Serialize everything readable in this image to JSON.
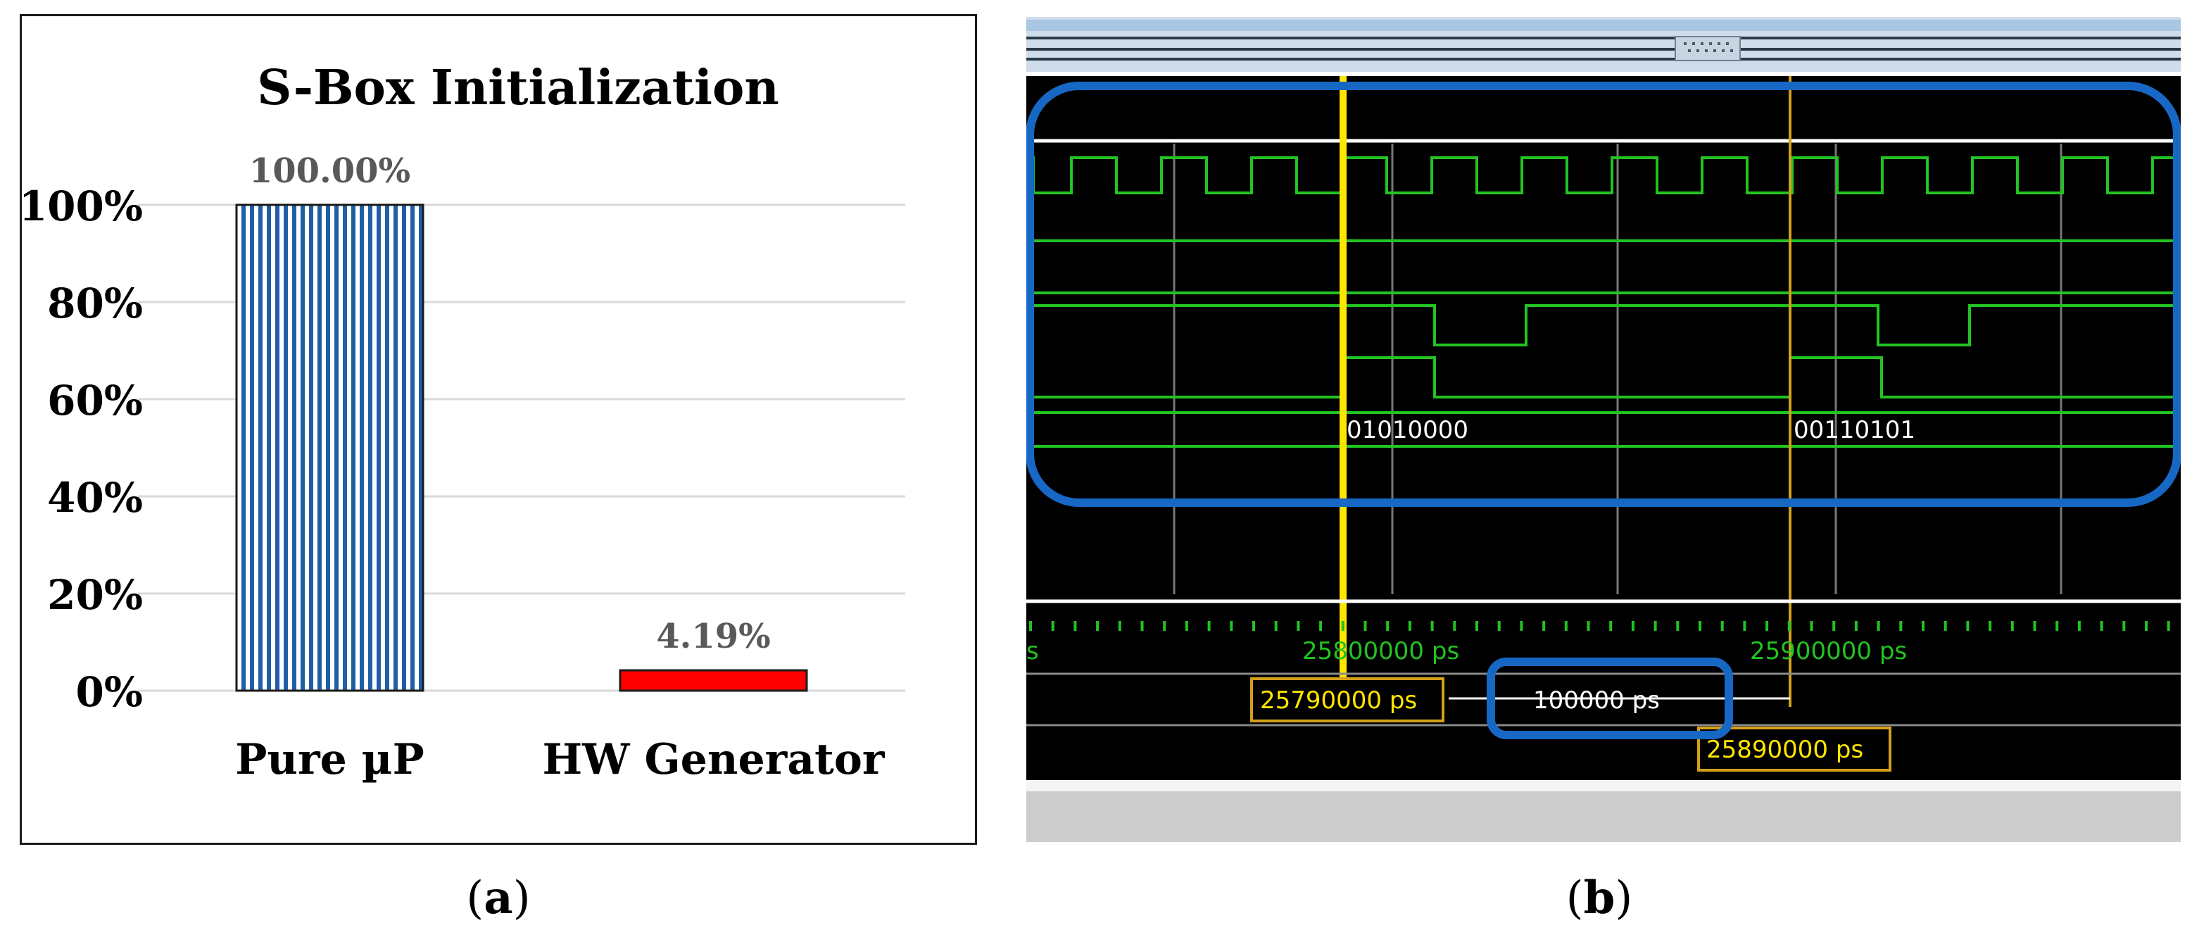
{
  "chart_data": {
    "type": "bar",
    "title": "S-Box Initialization",
    "categories": [
      "Pure µP",
      "HW Generator"
    ],
    "series": [
      {
        "values": [
          100.0,
          4.19
        ]
      }
    ],
    "data_labels": [
      "100.00%",
      "4.19%"
    ],
    "ylim": [
      0,
      100
    ],
    "y_ticks": [
      "0%",
      "20%",
      "40%",
      "60%",
      "80%",
      "100%"
    ],
    "y_tick_values": [
      0,
      20,
      40,
      60,
      80,
      100
    ],
    "grid": true,
    "legend": "none",
    "bar_styles": [
      "vertical-stripes-blue",
      "solid-red"
    ],
    "colors": {
      "stripe": "#1f5fa8",
      "red": "#ff0000",
      "grid": "#d9d9d9",
      "label": "#595959"
    }
  },
  "waveform": {
    "bus_values": [
      "01010000",
      "00110101"
    ],
    "ruler_labels": [
      "s",
      "25800000 ps",
      "25900000 ps"
    ],
    "cursor1_label": "25790000 ps",
    "cursor2_label": "25890000 ps",
    "delta_label": "100000 ps",
    "colors": {
      "signal": "#22c322",
      "cursor1": "#ffe600",
      "cursor2": "#d4a017",
      "highlight": "#1768c4",
      "background": "#000000"
    }
  },
  "subfigure_labels": {
    "a": {
      "open": "(",
      "letter": "a",
      "close": ")"
    },
    "b": {
      "open": "(",
      "letter": "b",
      "close": ")"
    }
  }
}
